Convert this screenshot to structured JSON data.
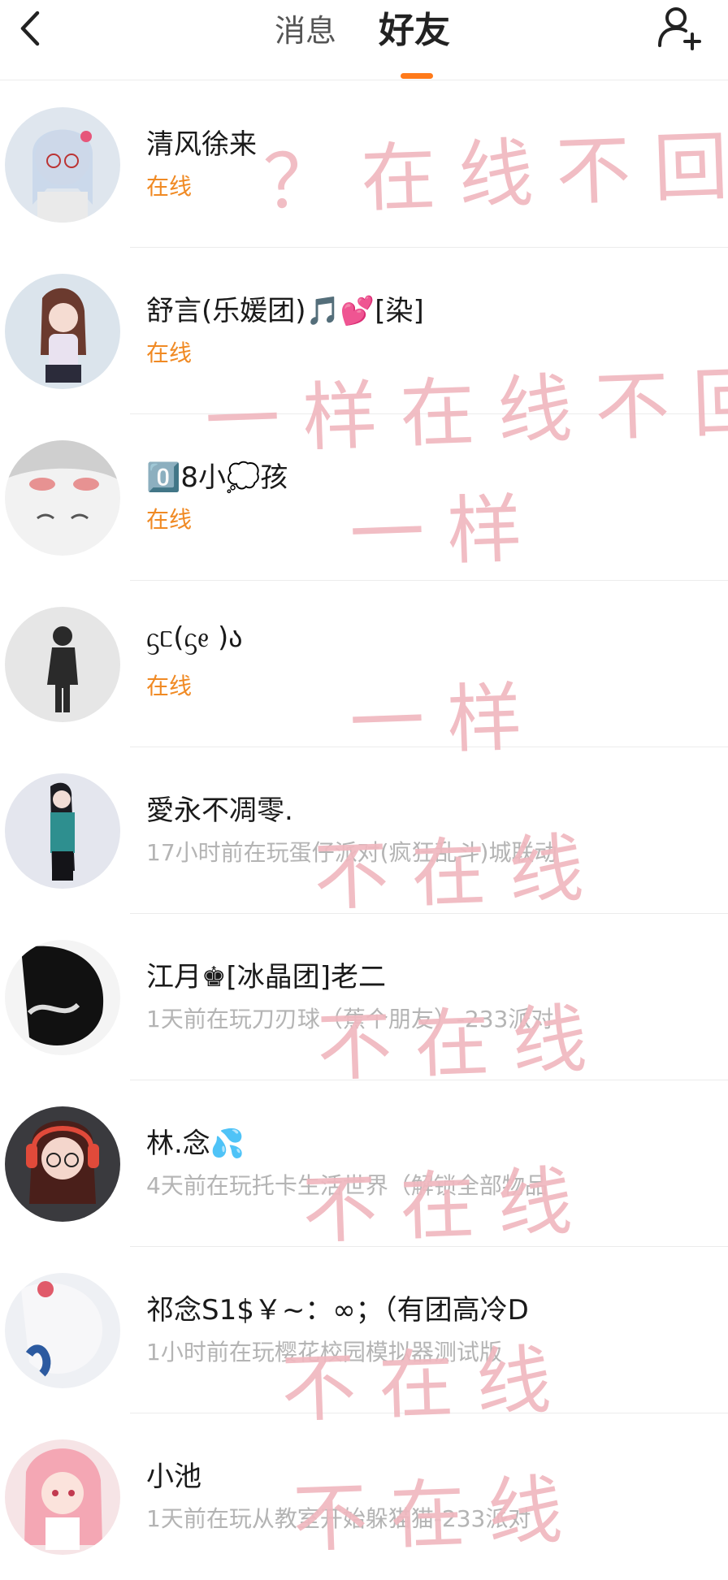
{
  "header": {
    "tabs": [
      {
        "label": "消息",
        "active": false
      },
      {
        "label": "好友",
        "active": true
      }
    ],
    "back_icon": "chevron-left-icon",
    "add_friend_icon": "add-user-icon",
    "accent_color": "#ff7a1a"
  },
  "friends": [
    {
      "name": "清风徐来",
      "status": "在线",
      "online": true
    },
    {
      "name": "舒言(乐媛团)🎵💕[染]",
      "status": "在线",
      "online": true
    },
    {
      "name": "0️⃣8小💭孩",
      "status": "在线",
      "online": true
    },
    {
      "name": "ᦓᥴ(ᦓᧉ )ა",
      "status": "在线",
      "online": true
    },
    {
      "name": "愛永不凋零.",
      "status": "17小时前在玩蛋仔派对(疯狂乱斗)城联动",
      "online": false
    },
    {
      "name": "江月♚[冰晶团]老二",
      "status": "1天前在玩刀刃球（蕉个朋友）-233派对",
      "online": false
    },
    {
      "name": "林.念💦",
      "status": "4天前在玩托卡生活世界（解锁全部物品",
      "online": false
    },
    {
      "name": "祁念S1$￥~：∞；（有团高冷D",
      "status": "1小时前在玩樱花校园模拟器测试版",
      "online": false
    },
    {
      "name": "小池",
      "status": "1天前在玩从教室开始躲猫猫-233派对",
      "online": false
    }
  ],
  "handwritten_notes": [
    "？在线不回",
    "一样在线不回",
    "一样",
    "一样",
    "不在线",
    "不在线",
    "不在线",
    "不在线",
    "不在线"
  ],
  "colors": {
    "online": "#f08a24",
    "offline": "#b4b4b4",
    "handwriting": "#f0b8bf"
  }
}
